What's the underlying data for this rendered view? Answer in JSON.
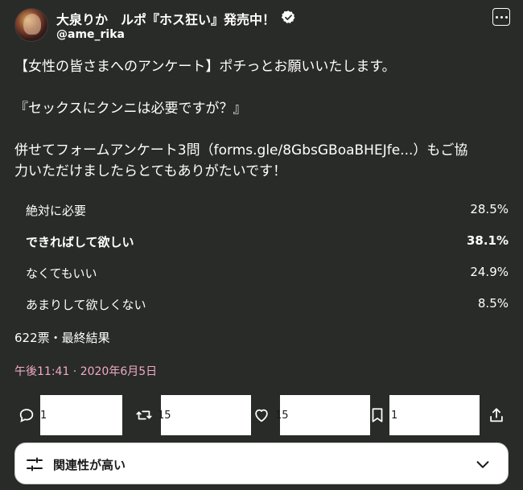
{
  "user": {
    "display_name": "大泉りか　ルポ『ホス狂い』発売中！",
    "handle": "@ame_rika"
  },
  "icons": {
    "more": "more-icon",
    "verified": "verified-badge-icon",
    "reply": "reply-icon",
    "retweet": "retweet-icon",
    "like": "like-icon",
    "bookmark": "bookmark-icon",
    "share": "share-icon",
    "sort": "sort-icon",
    "chevron": "chevron-down-icon"
  },
  "tweet": {
    "line1": "【女性の皆さまへのアンケート】ポチっとお願いいたします。",
    "line2": "『セックスにクンニは必要ですが？』",
    "line3": "併せてフォームアンケート3問（forms.gle/8GbsGBoaBHEJfe...）もご協",
    "line4": "力いただけましたらとてもありがたいです！"
  },
  "poll": {
    "options": [
      {
        "label": "絶対に必要",
        "percent": "28.5%",
        "value": 28.5
      },
      {
        "label": "できればして欲しい",
        "percent": "38.1%",
        "value": 38.1
      },
      {
        "label": "なくてもいい",
        "percent": "24.9%",
        "value": 24.9
      },
      {
        "label": "あまりして欲しくない",
        "percent": "8.5%",
        "value": 8.5
      }
    ],
    "meta": "622票・最終結果"
  },
  "timestamp": "午後11:41 · 2020年6月5日",
  "actions": {
    "reply_count": "1",
    "retweet_count": "15",
    "like_count": "15",
    "bookmark_count": "1"
  },
  "sort": {
    "label": "関連性が高い"
  },
  "colors": {
    "background": "#282b27",
    "timestamp": "#f0a9c8",
    "text": "#ffffff"
  }
}
